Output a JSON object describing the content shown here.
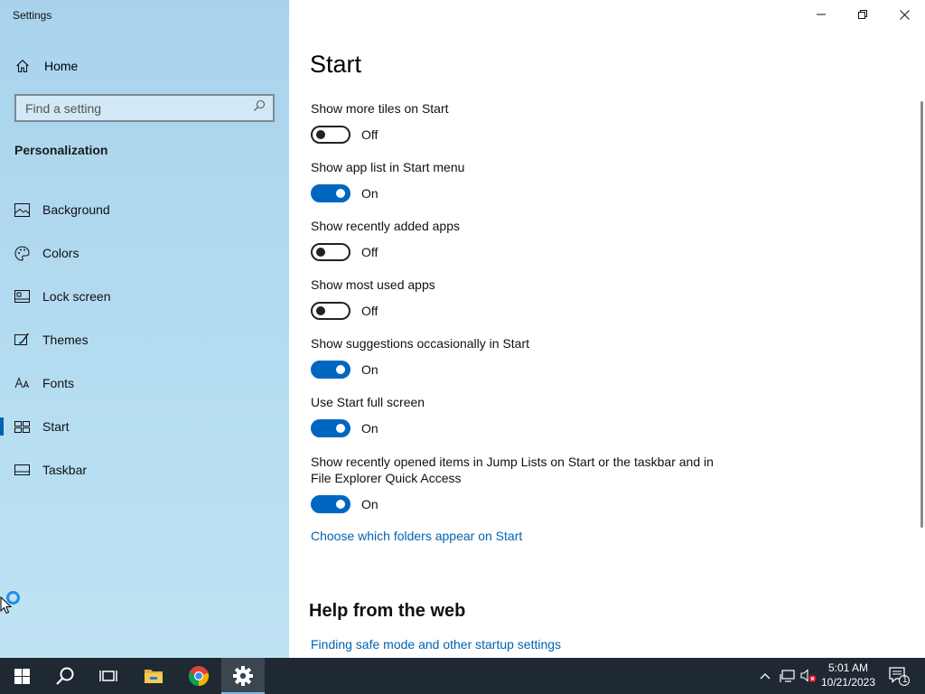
{
  "window": {
    "title": "Settings",
    "controls": [
      "minimize",
      "restore",
      "close"
    ]
  },
  "sidebar": {
    "home_label": "Home",
    "search_placeholder": "Find a setting",
    "section": "Personalization",
    "items": [
      {
        "label": "Background",
        "icon": "picture-icon"
      },
      {
        "label": "Colors",
        "icon": "palette-icon"
      },
      {
        "label": "Lock screen",
        "icon": "lock-screen-icon"
      },
      {
        "label": "Themes",
        "icon": "brush-icon"
      },
      {
        "label": "Fonts",
        "icon": "font-icon"
      },
      {
        "label": "Start",
        "icon": "start-tiles-icon",
        "active": true
      },
      {
        "label": "Taskbar",
        "icon": "taskbar-icon"
      }
    ]
  },
  "main": {
    "title": "Start",
    "settings": [
      {
        "label": "Show more tiles on Start",
        "state": "Off"
      },
      {
        "label": "Show app list in Start menu",
        "state": "On"
      },
      {
        "label": "Show recently added apps",
        "state": "Off"
      },
      {
        "label": "Show most used apps",
        "state": "Off"
      },
      {
        "label": "Show suggestions occasionally in Start",
        "state": "On"
      },
      {
        "label": "Use Start full screen",
        "state": "On"
      },
      {
        "label_line1": "Show recently opened items in Jump Lists on Start or the taskbar and in",
        "label_line2": "File Explorer Quick Access",
        "state": "On"
      }
    ],
    "folders_link": "Choose which folders appear on Start",
    "help_heading": "Help from the web",
    "help_link": "Finding safe mode and other startup settings"
  },
  "taskbar": {
    "apps": [
      "start-button",
      "search",
      "task-view",
      "file-explorer",
      "chrome",
      "settings"
    ],
    "time": "5:01 AM",
    "date": "10/21/2023",
    "notification_count": "1"
  },
  "colors": {
    "accent": "#0067c0",
    "link": "#0063b1",
    "taskbar": "#1f2933"
  }
}
